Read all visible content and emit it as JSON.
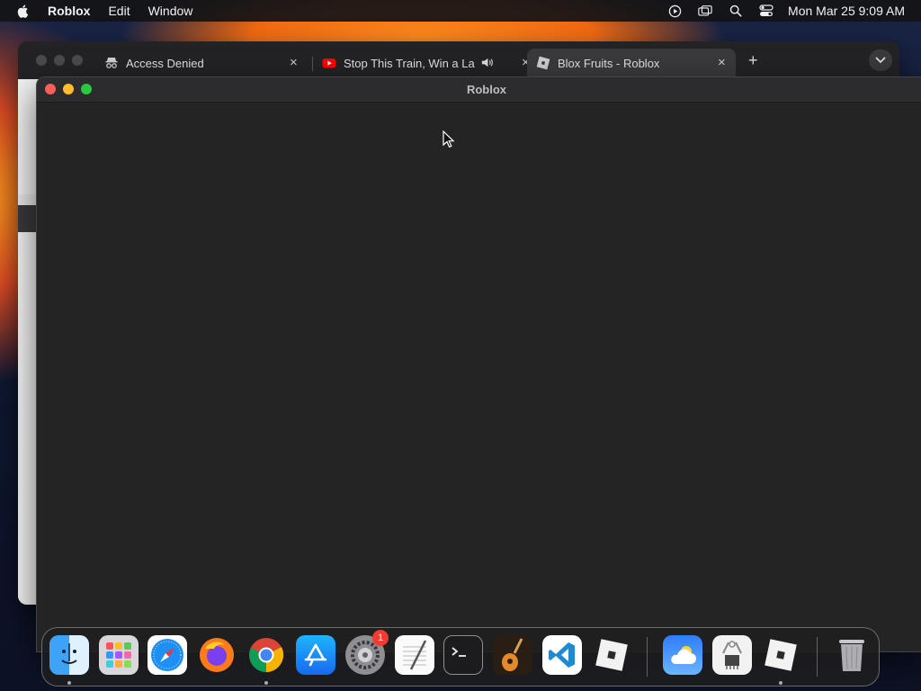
{
  "menubar": {
    "app_name": "Roblox",
    "items": [
      "Edit",
      "Window"
    ],
    "clock": "Mon Mar 25  9:09 AM",
    "status_icons": [
      "screen-record-icon",
      "screen-mirror-icon",
      "spotlight-search-icon",
      "control-center-icon"
    ]
  },
  "browser": {
    "tabs": [
      {
        "label": "Access Denied",
        "icon": "incognito-favicon",
        "active": false
      },
      {
        "label": "Stop This Train, Win a Lar",
        "icon": "youtube-favicon",
        "active": false,
        "audio": true
      },
      {
        "label": "Blox Fruits - Roblox",
        "icon": "roblox-favicon",
        "active": true
      }
    ],
    "close_glyph": "×",
    "new_tab_glyph": "+"
  },
  "roblox_window": {
    "title": "Roblox"
  },
  "dock": {
    "apps": [
      {
        "name": "finder-icon",
        "running": true
      },
      {
        "name": "launchpad-icon",
        "running": false
      },
      {
        "name": "safari-icon",
        "running": false
      },
      {
        "name": "firefox-icon",
        "running": false
      },
      {
        "name": "chrome-icon",
        "running": true
      },
      {
        "name": "app-store-icon",
        "running": false
      },
      {
        "name": "system-settings-icon",
        "running": false,
        "badge": "1"
      },
      {
        "name": "textedit-icon",
        "running": false
      },
      {
        "name": "terminal-icon",
        "running": false
      },
      {
        "name": "garageband-icon",
        "running": false
      },
      {
        "name": "vscode-icon",
        "running": false
      },
      {
        "name": "roblox-icon",
        "running": false
      },
      {
        "name": "weather-icon",
        "running": false
      },
      {
        "name": "system-information-icon",
        "running": false
      },
      {
        "name": "roblox-player-icon",
        "running": true
      },
      {
        "name": "trash-icon",
        "running": false
      }
    ]
  }
}
